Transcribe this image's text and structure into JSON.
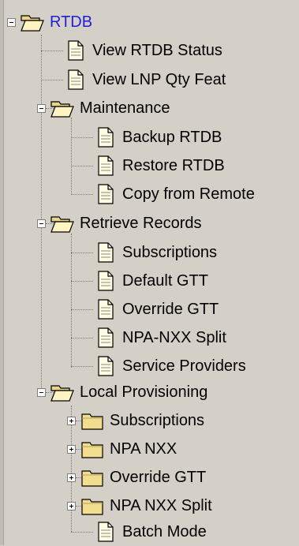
{
  "tree": {
    "root": {
      "label": "RTDB"
    },
    "items": [
      {
        "label": "View RTDB Status"
      },
      {
        "label": "View LNP Qty Feat"
      },
      {
        "label": "Maintenance"
      },
      {
        "label": "Backup RTDB"
      },
      {
        "label": "Restore RTDB"
      },
      {
        "label": "Copy from Remote"
      },
      {
        "label": "Retrieve Records"
      },
      {
        "label": "Subscriptions"
      },
      {
        "label": "Default GTT"
      },
      {
        "label": "Override GTT"
      },
      {
        "label": "NPA-NXX Split"
      },
      {
        "label": "Service Providers"
      },
      {
        "label": "Local Provisioning"
      },
      {
        "label": "Subscriptions"
      },
      {
        "label": "NPA NXX"
      },
      {
        "label": "Override GTT"
      },
      {
        "label": "NPA NXX Split"
      },
      {
        "label": "Batch Mode"
      }
    ]
  }
}
